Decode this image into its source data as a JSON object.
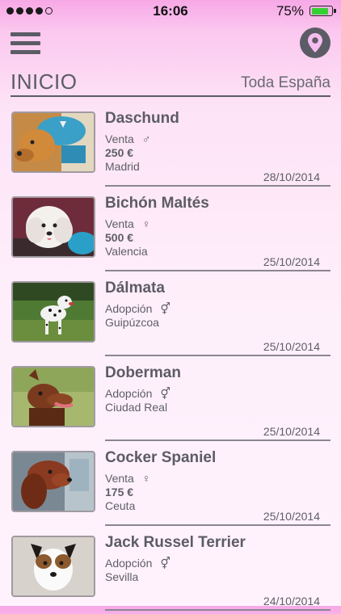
{
  "status_bar": {
    "signal_dots_filled": 4,
    "signal_dots_total": 5,
    "time": "16:06",
    "battery_percent": "75%",
    "battery_level": 0.85
  },
  "header": {
    "menu_icon": "hamburger-menu-icon",
    "location_icon": "map-pin-icon",
    "title": "INICIO",
    "region": "Toda España"
  },
  "listings": [
    {
      "name": "Daschund",
      "type": "Venta",
      "sex_symbol": "♂",
      "price": "250 €",
      "location": "Madrid",
      "date": "28/10/2014",
      "photo": "dachshund"
    },
    {
      "name": "Bichón Maltés",
      "type": "Venta",
      "sex_symbol": "♀",
      "price": "500 €",
      "location": "Valencia",
      "date": "25/10/2014",
      "photo": "maltese"
    },
    {
      "name": "Dálmata",
      "type": "Adopción",
      "sex_symbol": "⚥",
      "price": "",
      "location": "Guipúzcoa",
      "date": "25/10/2014",
      "photo": "dalmatian"
    },
    {
      "name": "Doberman",
      "type": "Adopción",
      "sex_symbol": "⚥",
      "price": "",
      "location": "Ciudad Real",
      "date": "25/10/2014",
      "photo": "doberman"
    },
    {
      "name": "Cocker Spaniel",
      "type": "Venta",
      "sex_symbol": "♀",
      "price": "175 €",
      "location": "Ceuta",
      "date": "25/10/2014",
      "photo": "cocker-spaniel"
    },
    {
      "name": "Jack Russel Terrier",
      "type": "Adopción",
      "sex_symbol": "⚥",
      "price": "",
      "location": "Sevilla",
      "date": "24/10/2014",
      "photo": "jack-russell"
    }
  ],
  "colors": {
    "accent": "#5c5c66",
    "battery": "#35d134",
    "background_top": "#f7a8e6",
    "background_bottom": "#fff2fc"
  }
}
